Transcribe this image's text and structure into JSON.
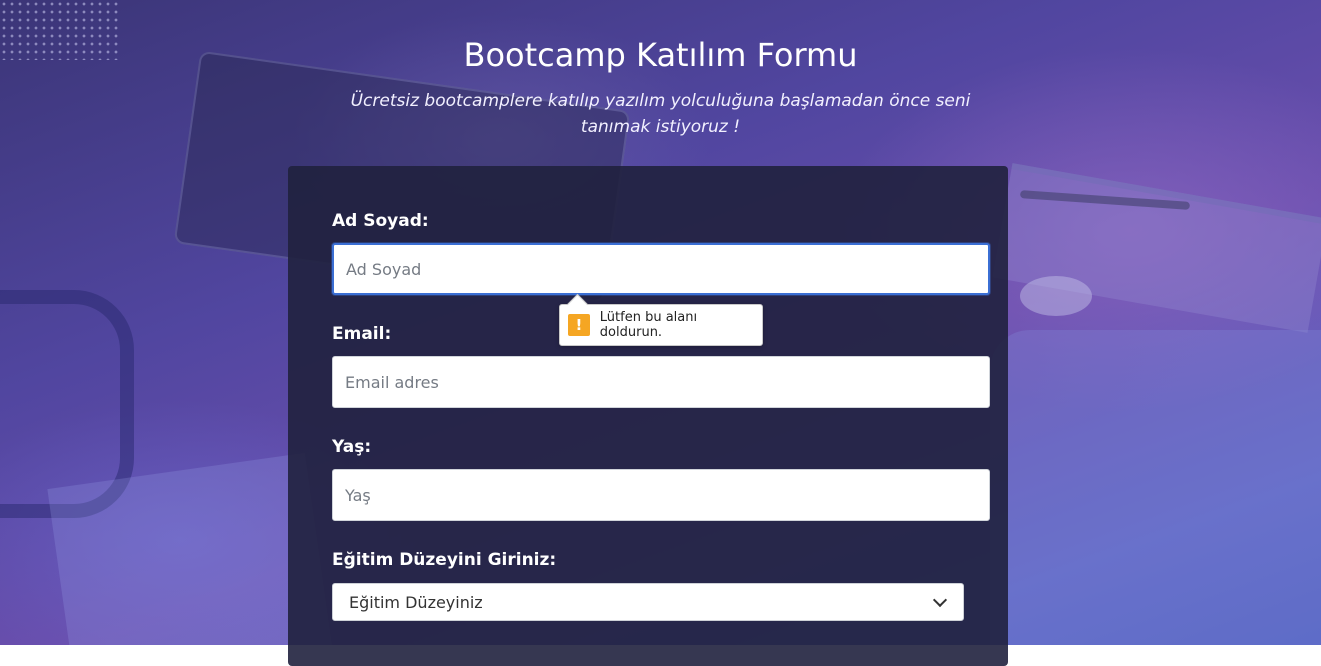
{
  "header": {
    "title": "Bootcamp Katılım Formu",
    "subtitle": "Ücretsiz bootcamplere katılıp yazılım yolculuğuna başlamadan önce seni tanımak istiyoruz !"
  },
  "form": {
    "name": {
      "label": "Ad Soyad:",
      "placeholder": "Ad Soyad",
      "value": ""
    },
    "email": {
      "label": "Email:",
      "placeholder": "Email adres",
      "value": ""
    },
    "age": {
      "label": "Yaş:",
      "placeholder": "Yaş",
      "value": ""
    },
    "education": {
      "label": "Eğitim Düzeyini Giriniz:",
      "selected": "Eğitim Düzeyiniz"
    }
  },
  "validation": {
    "icon": "warning-icon",
    "icon_glyph": "!",
    "message": "Lütfen bu alanı doldurun."
  },
  "colors": {
    "focus_border": "#3b6fd4",
    "warning": "#f5a623",
    "card_background": "#20213e"
  }
}
